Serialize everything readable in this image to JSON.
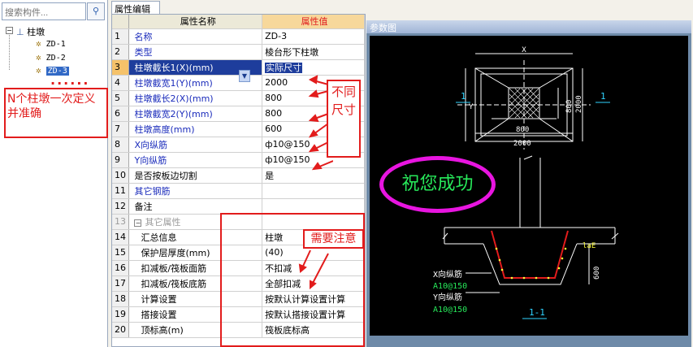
{
  "search": {
    "placeholder": "搜索构件...",
    "btn": "ρ"
  },
  "tree": {
    "root": "柱墩",
    "items": [
      "ZD-1",
      "ZD-2",
      "ZD-3"
    ],
    "expand": "−"
  },
  "notes": {
    "left": "N个柱墩一次定义并准确",
    "dots": "......",
    "notdiff": "不同尺寸",
    "need": "需要注意",
    "success": "祝您成功"
  },
  "tab": "属性编辑",
  "grid": {
    "headers": [
      "属性名称",
      "属性值"
    ],
    "rows": [
      {
        "n": "1",
        "k": "名称",
        "v": "ZD-3",
        "blue": true
      },
      {
        "n": "2",
        "k": "类型",
        "v": "棱台形下柱墩",
        "blue": true
      },
      {
        "n": "3",
        "k": "柱墩截长1(X)(mm)",
        "v": "实际尺寸",
        "blue": true
      },
      {
        "n": "4",
        "k": "柱墩截宽1(Y)(mm)",
        "v": "2000",
        "blue": true
      },
      {
        "n": "5",
        "k": "柱墩截长2(X)(mm)",
        "v": "800",
        "blue": true
      },
      {
        "n": "6",
        "k": "柱墩截宽2(Y)(mm)",
        "v": "800",
        "blue": true
      },
      {
        "n": "7",
        "k": "柱墩高度(mm)",
        "v": "600",
        "blue": true
      },
      {
        "n": "8",
        "k": "X向纵筋",
        "v": "ф10@150",
        "blue": true
      },
      {
        "n": "9",
        "k": "Y向纵筋",
        "v": "ф10@150",
        "blue": true
      },
      {
        "n": "10",
        "k": "是否按板边切割",
        "v": "是",
        "blue": false
      },
      {
        "n": "11",
        "k": "其它钢筋",
        "v": "",
        "blue": true
      },
      {
        "n": "12",
        "k": "备注",
        "v": "",
        "blue": false
      },
      {
        "n": "13",
        "k": "其它属性",
        "v": "",
        "blue": false
      },
      {
        "n": "14",
        "k": "汇总信息",
        "v": "柱墩",
        "blue": false
      },
      {
        "n": "15",
        "k": "保护层厚度(mm)",
        "v": "(40)",
        "blue": false
      },
      {
        "n": "16",
        "k": "扣减板/筏板面筋",
        "v": "不扣减",
        "blue": false
      },
      {
        "n": "17",
        "k": "扣减板/筏板底筋",
        "v": "全部扣减",
        "blue": false
      },
      {
        "n": "18",
        "k": "计算设置",
        "v": "按默认计算设置计算",
        "blue": false
      },
      {
        "n": "19",
        "k": "搭接设置",
        "v": "按默认搭接设置计算",
        "blue": false
      },
      {
        "n": "20",
        "k": "顶标高(m)",
        "v": "筏板底标高",
        "blue": false
      }
    ]
  },
  "panel": {
    "title": "参数图"
  },
  "drawing": {
    "x": "X",
    "y": "Y",
    "xlabel": "X",
    "dim800a": "800",
    "dim800b": "800",
    "dim2000a": "2000",
    "dim2000b": "2000",
    "sec1": "1",
    "sec1b": "1",
    "lae": "laE",
    "d600": "600",
    "xbar": "X向纵筋",
    "xbarv": "A10@150",
    "ybar": "Y向纵筋",
    "ybarv": "A10@150",
    "sect": "1-1"
  },
  "colors": {
    "accent": "#e21c1c",
    "success": "#27e85a",
    "ring": "#e815e0"
  }
}
